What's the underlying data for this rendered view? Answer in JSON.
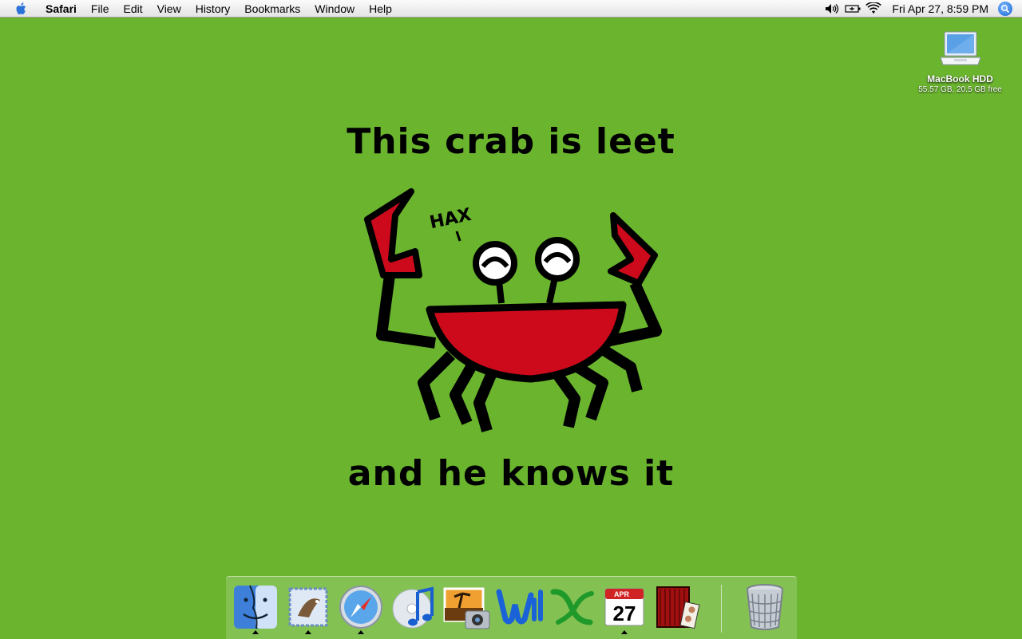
{
  "menubar": {
    "app_name": "Safari",
    "menus": [
      "File",
      "Edit",
      "View",
      "History",
      "Bookmarks",
      "Window",
      "Help"
    ],
    "clock": "Fri Apr 27, 8:59 PM",
    "status_icons": [
      "volume-icon",
      "battery-icon",
      "wifi-icon"
    ]
  },
  "desktop": {
    "hdd_name": "MacBook HDD",
    "hdd_info": "55.57 GB, 20.5 GB free"
  },
  "wallpaper": {
    "line1": "This crab is leet",
    "line2": "and he knows it",
    "crab_speech": "HAX",
    "background_color": "#6ab42e",
    "crab_color": "#cc0a1c"
  },
  "dock": {
    "items": [
      "finder-icon",
      "mail-icon",
      "safari-icon",
      "itunes-icon",
      "iphoto-icon",
      "word-icon",
      "excel-icon",
      "ical-icon",
      "photo-booth-icon",
      "trash-icon"
    ],
    "ical_month": "APR",
    "ical_day": "27"
  }
}
